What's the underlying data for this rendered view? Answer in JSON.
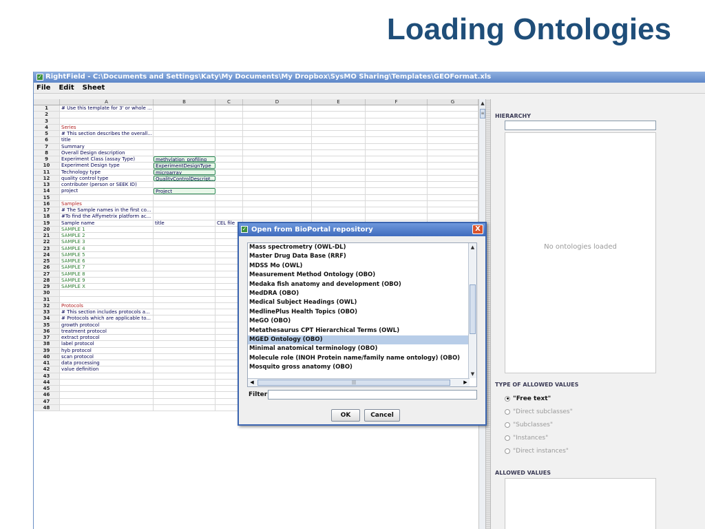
{
  "slide": {
    "title": "Loading Ontologies"
  },
  "window": {
    "title": "RightField - C:\\Documents and Settings\\Katy\\My Documents\\My Dropbox\\SysMO Sharing\\Templates\\GEOFormat.xls",
    "menu": [
      "File",
      "Edit",
      "Sheet"
    ]
  },
  "sheet": {
    "columns": [
      "A",
      "B",
      "C",
      "D",
      "E",
      "F",
      "G"
    ],
    "rows": [
      {
        "n": "1",
        "a": "# Use this template for 3' or whole ...",
        "b": ""
      },
      {
        "n": "2",
        "a": "",
        "b": ""
      },
      {
        "n": "3",
        "a": "",
        "b": ""
      },
      {
        "n": "4",
        "a": "Series",
        "b": ""
      },
      {
        "n": "5",
        "a": "# This section describes the overall...",
        "b": ""
      },
      {
        "n": "6",
        "a": "title",
        "b": ""
      },
      {
        "n": "7",
        "a": "Summary",
        "b": ""
      },
      {
        "n": "8",
        "a": "Overall Design description",
        "b": ""
      },
      {
        "n": "9",
        "a": "Experiment Class (assay Type)",
        "b": "methylation_profiling"
      },
      {
        "n": "10",
        "a": "Experiment Design type",
        "b": "ExperimentDesignType"
      },
      {
        "n": "11",
        "a": "Technology type",
        "b": "microarray"
      },
      {
        "n": "12",
        "a": "quality control type",
        "b": "QualityControlDescript..."
      },
      {
        "n": "13",
        "a": "contributer (person or SEEK ID)",
        "b": ""
      },
      {
        "n": "14",
        "a": "project",
        "b": "Project"
      },
      {
        "n": "15",
        "a": "",
        "b": ""
      },
      {
        "n": "16",
        "a": "Samples",
        "b": ""
      },
      {
        "n": "17",
        "a": "# The Sample names in the first co...",
        "b": ""
      },
      {
        "n": "18",
        "a": "#To find the Affymetrix platform ac...",
        "b": ""
      },
      {
        "n": "19",
        "a": "Sample name",
        "b": "title",
        "c": "CEL file"
      },
      {
        "n": "20",
        "a": "SAMPLE 1",
        "b": ""
      },
      {
        "n": "21",
        "a": "SAMPLE 2",
        "b": ""
      },
      {
        "n": "22",
        "a": "SAMPLE 3",
        "b": ""
      },
      {
        "n": "23",
        "a": "SAMPLE 4",
        "b": ""
      },
      {
        "n": "24",
        "a": "SAMPLE 5",
        "b": ""
      },
      {
        "n": "25",
        "a": "SAMPLE 6",
        "b": ""
      },
      {
        "n": "26",
        "a": "SAMPLE 7",
        "b": ""
      },
      {
        "n": "27",
        "a": "SAMPLE 8",
        "b": ""
      },
      {
        "n": "28",
        "a": "SAMPLE 9",
        "b": ""
      },
      {
        "n": "29",
        "a": "SAMPLE X",
        "b": ""
      },
      {
        "n": "30",
        "a": "",
        "b": ""
      },
      {
        "n": "31",
        "a": "",
        "b": ""
      },
      {
        "n": "32",
        "a": "Protocols",
        "b": ""
      },
      {
        "n": "33",
        "a": "# This section includes protocols a...",
        "b": ""
      },
      {
        "n": "34",
        "a": "# Protocols which are applicable to...",
        "b": ""
      },
      {
        "n": "35",
        "a": "growth protocol",
        "b": ""
      },
      {
        "n": "36",
        "a": "treatment protocol",
        "b": ""
      },
      {
        "n": "37",
        "a": "extract protocol",
        "b": ""
      },
      {
        "n": "38",
        "a": "label protocol",
        "b": ""
      },
      {
        "n": "39",
        "a": "hyb protocol",
        "b": ""
      },
      {
        "n": "40",
        "a": "scan protocol",
        "b": ""
      },
      {
        "n": "41",
        "a": "data processing",
        "b": ""
      },
      {
        "n": "42",
        "a": "value definition",
        "b": ""
      },
      {
        "n": "43",
        "a": "",
        "b": ""
      },
      {
        "n": "44",
        "a": "",
        "b": ""
      },
      {
        "n": "45",
        "a": "",
        "b": ""
      },
      {
        "n": "46",
        "a": "",
        "b": ""
      },
      {
        "n": "47",
        "a": "",
        "b": ""
      },
      {
        "n": "48",
        "a": "",
        "b": ""
      }
    ]
  },
  "right_panel": {
    "hierarchy_label": "HIERARCHY",
    "no_ontologies": "No ontologies loaded",
    "allowed_type_label": "TYPE OF ALLOWED VALUES",
    "radios": [
      {
        "label": "\"Free text\"",
        "selected": true
      },
      {
        "label": "\"Direct subclasses\"",
        "selected": false
      },
      {
        "label": "\"Subclasses\"",
        "selected": false
      },
      {
        "label": "\"Instances\"",
        "selected": false
      },
      {
        "label": "\"Direct instances\"",
        "selected": false
      }
    ],
    "allowed_values_label": "ALLOWED VALUES"
  },
  "dialog": {
    "title": "Open from BioPortal repository",
    "close": "X",
    "items": [
      "Mass spectrometry (OWL-DL)",
      "Master Drug Data Base (RRF)",
      "MDSS Mo (OWL)",
      "Measurement Method Ontology (OBO)",
      "Medaka fish anatomy and development (OBO)",
      "MedDRA (OBO)",
      "Medical Subject Headings (OWL)",
      "MedlinePlus Health Topics (OBO)",
      "MeGO (OBO)",
      "Metathesaurus CPT Hierarchical Terms (OWL)",
      "MGED Ontology (OBO)",
      "Minimal anatomical terminology (OBO)",
      "Molecule role (INOH Protein name/family name ontology) (OBO)",
      "Mosquito gross anatomy (OBO)"
    ],
    "selected_index": 10,
    "filter_label": "Filter:",
    "filter_value": "",
    "ok": "OK",
    "cancel": "Cancel"
  }
}
